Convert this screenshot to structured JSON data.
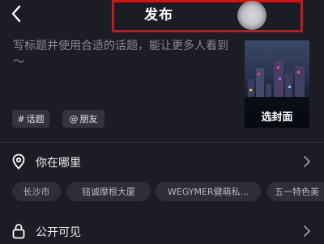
{
  "header": {
    "title": "发布",
    "back_icon": "chevron-left-icon"
  },
  "caption": {
    "placeholder": "写标题并使用合适的话题，能让更多人看到～"
  },
  "cover": {
    "label": "选封面"
  },
  "chips": [
    {
      "prefix": "#",
      "label": "话题"
    },
    {
      "prefix": "@",
      "label": "朋友"
    }
  ],
  "location": {
    "label": "你在哪里",
    "icon": "location-pin-icon"
  },
  "location_suggestions": [
    "长沙市",
    "铭诚摩根大厦",
    "WEGYMER健萌私...",
    "五一特色美"
  ],
  "privacy": {
    "label": "公开可见",
    "icon": "lock-icon"
  },
  "colors": {
    "background": "#1c1c24",
    "highlight_box": "#c01a1a",
    "chip_bg": "#34343e"
  }
}
